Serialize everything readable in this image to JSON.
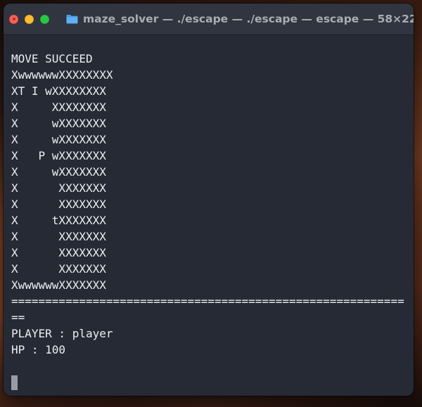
{
  "window": {
    "title": "maze_solver — ./escape — ./escape — escape — 58×22",
    "folder_icon": "folder-icon",
    "colors": {
      "close": "#fe5f57",
      "minimize": "#febc2e",
      "zoom": "#28c840",
      "terminal_bg": "#262a35",
      "text": "#eceef2"
    }
  },
  "terminal": {
    "status": "MOVE SUCCEED",
    "maze": [
      "XwwwwwwXXXXXXXX",
      "XT I wXXXXXXXX",
      "X     XXXXXXXX",
      "X     wXXXXXXX",
      "X     wXXXXXXX",
      "X   P wXXXXXXX",
      "X     wXXXXXXX",
      "X      XXXXXXX",
      "X      XXXXXXX",
      "X     tXXXXXXX",
      "X      XXXXXXX",
      "X      XXXXXXX",
      "X      XXXXXXX",
      "XwwwwwwXXXXXXX"
    ],
    "separator_1": "==========================================================",
    "separator_2": "==",
    "player_line": "PLAYER : player",
    "hp_line": "HP : 100"
  }
}
